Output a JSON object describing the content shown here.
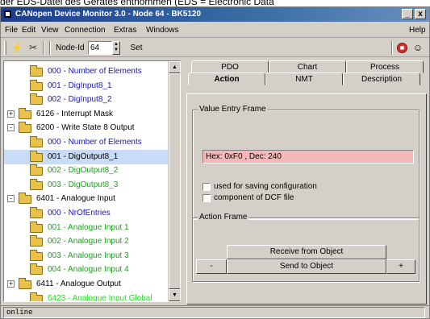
{
  "caption_text": "der EDS-Datei des Gerätes entnommen (EDS = Electronic Data",
  "window": {
    "title": "CANopen Device Monitor 3.0 - Node 64 - BK5120",
    "minimize": "_",
    "close": "x"
  },
  "menu": {
    "file": "File",
    "edit": "Edit",
    "view": "View",
    "connection": "Connection",
    "extras": "Extras",
    "windows": "Windows",
    "help": "Help"
  },
  "toolbar": {
    "node_label": "Node-Id",
    "node_value": "64",
    "set_label": "Set"
  },
  "icons": {
    "connect": "connect-icon",
    "disconnect": "disconnect-icon",
    "stop": "stop-icon",
    "user": "user-icon"
  },
  "tree": {
    "rows": [
      {
        "text": "000 - Number of Elements",
        "color": "#1a1aa8"
      },
      {
        "text": "001 - DigInput8_1",
        "color": "#1a1aa8"
      },
      {
        "text": "002 - DigInput8_2",
        "color": "#1a1aa8"
      },
      {
        "text": "6126 - Interrupt Mask",
        "color": "#000000"
      },
      {
        "text": "6200 - Write State 8 Output",
        "color": "#000000"
      },
      {
        "text": "000 - Number of Elements",
        "color": "#1a1aa8"
      },
      {
        "text": "001 - DigOutput8_1",
        "color": "#000000"
      },
      {
        "text": "002 - DigOutput8_2",
        "color": "#20a020"
      },
      {
        "text": "003 - DigOutput8_3",
        "color": "#20a020"
      },
      {
        "text": "6401 - Analogue Input",
        "color": "#000000"
      },
      {
        "text": "000 - NrOfEntries",
        "color": "#1a1aa8"
      },
      {
        "text": "001 - Analogue Input 1",
        "color": "#20a020"
      },
      {
        "text": "002 - Analogue Input 2",
        "color": "#20a020"
      },
      {
        "text": "003 - Analogue Input 3",
        "color": "#20a020"
      },
      {
        "text": "004 - Analogue Input 4",
        "color": "#20a020"
      },
      {
        "text": "6411 - Analogue Output",
        "color": "#000000"
      },
      {
        "text": "6423 - Analogue Input Global",
        "color": "#20e020"
      }
    ],
    "selected": "001 - DigOutput8_1"
  },
  "tabs": {
    "row_back": [
      "PDO",
      "Chart",
      "Process"
    ],
    "row_front": [
      "Action",
      "NMT",
      "Description"
    ],
    "active": "Action"
  },
  "value_frame": {
    "title": "Value Entry Frame",
    "value": "Hex: 0xF0 , Dec: 240",
    "value_bg": "#f4b8b8",
    "check_saving": "used for saving configuration",
    "check_dcf": "component of DCF file"
  },
  "action_frame": {
    "title": "Action Frame",
    "receive": "Receive from Object",
    "send": "Send to Object",
    "minus": "-",
    "plus": "+"
  },
  "status": {
    "text": "online"
  }
}
